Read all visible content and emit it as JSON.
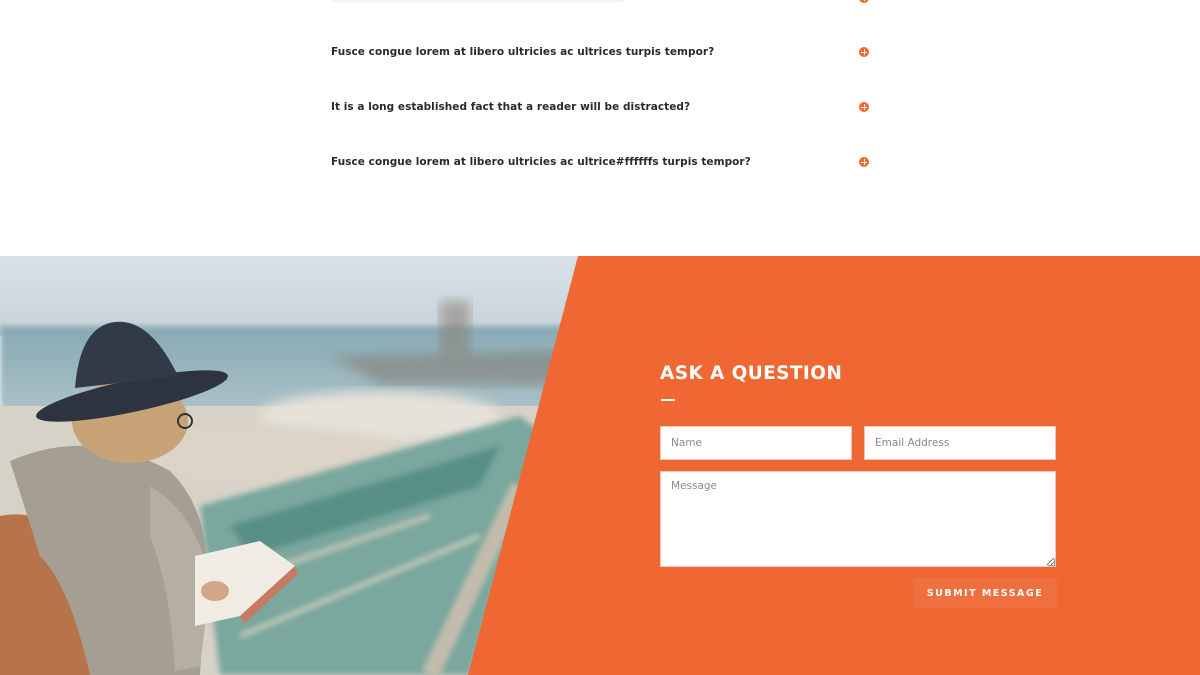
{
  "faq": {
    "items": [
      {
        "question": "Fusce congue lorem at libero ultricies ac ultrices turpis tempor?"
      },
      {
        "question": "It is a long established fact that a reader will be distracted?"
      },
      {
        "question": "Fusce congue lorem at libero ultricies ac ultrice#ffffffs turpis tempor?"
      }
    ],
    "toggle_icon": "plus-circle-icon"
  },
  "contact": {
    "title": "ASK A QUESTION",
    "name_placeholder": "Name",
    "email_placeholder": "Email Address",
    "message_placeholder": "Message",
    "submit_label": "SUBMIT MESSAGE"
  },
  "colors": {
    "accent": "#ef6833",
    "question_text": "#2a2a2a",
    "form_text": "#ffffff"
  }
}
